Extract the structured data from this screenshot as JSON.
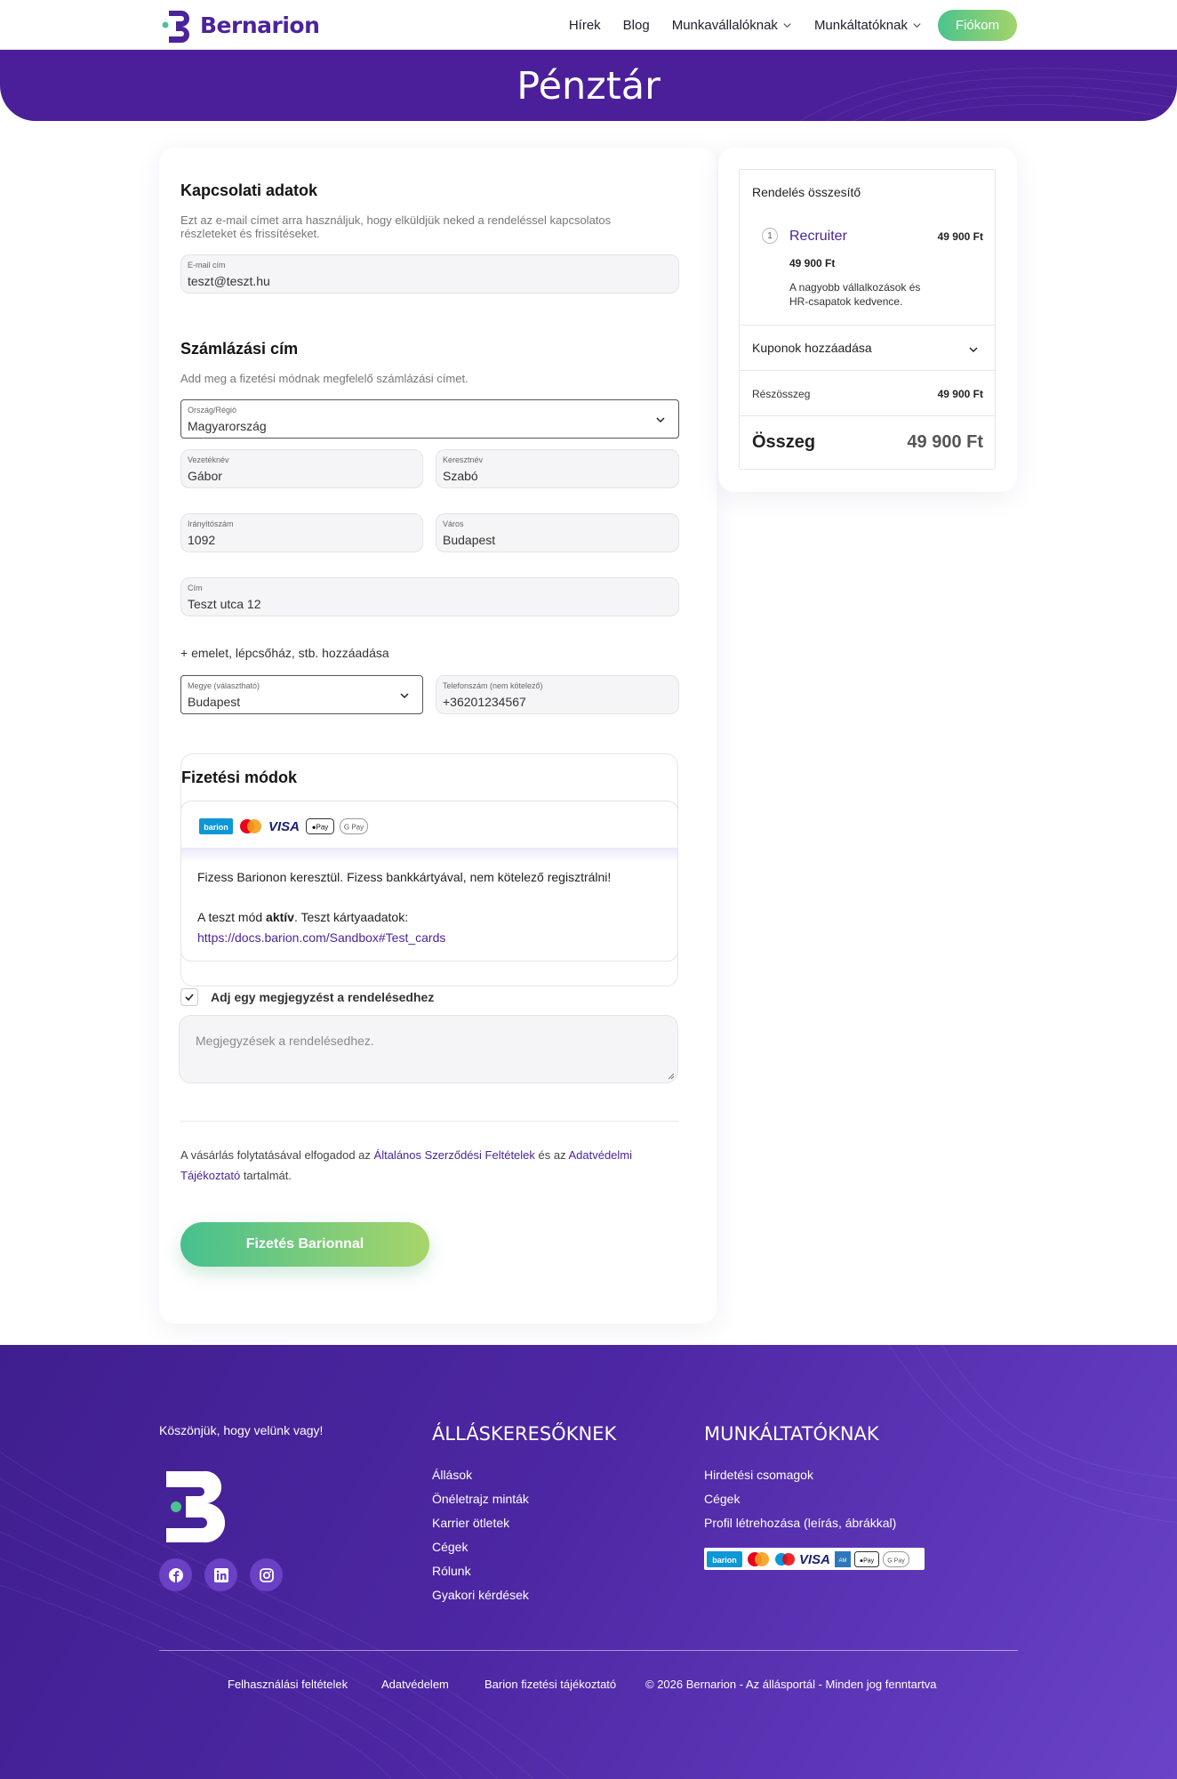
{
  "brand": {
    "name": "Bernarion",
    "accent": "#4b1f99",
    "green": "#4cc38d",
    "lime": "#a8d56a"
  },
  "nav": {
    "items": [
      "Hírek",
      "Blog",
      "Munkavállalóknak",
      "Munkáltatóknak"
    ],
    "account": "Fiókom"
  },
  "page_title": "Pénztár",
  "contact": {
    "title": "Kapcsolati adatok",
    "desc": "Ezt az e-mail címet arra használjuk, hogy elküldjük neked a rendeléssel kapcsolatos részleteket és frissítéseket.",
    "email_label": "E-mail cím",
    "email_value": "teszt@teszt.hu"
  },
  "billing": {
    "title": "Számlázási cím",
    "desc": "Add meg a fizetési módnak megfelelő számlázási címet.",
    "country_label": "Ország/Régió",
    "country_value": "Magyarország",
    "lastname_label": "Vezetéknév",
    "lastname_value": "Gábor",
    "firstname_label": "Keresztnév",
    "firstname_value": "Szabó",
    "zip_label": "Irányítószám",
    "zip_value": "1092",
    "city_label": "Város",
    "city_value": "Budapest",
    "address_label": "Cím",
    "address_value": "Teszt utca 12",
    "add_more": "+ emelet, lépcsőház, stb. hozzáadása",
    "county_label": "Megye (választható)",
    "county_value": "Budapest",
    "phone_label": "Telefonszám (nem kötelező)",
    "phone_value": "+36201234567"
  },
  "payment": {
    "title": "Fizetési módok",
    "logos": [
      "barion",
      "mastercard",
      "VISA",
      "Apple Pay",
      "G Pay"
    ],
    "desc": "Fizess Barionon keresztül. Fizess bankkártyával, nem kötelező regisztrálni!",
    "test_prefix": "A teszt mód ",
    "test_bold": "aktív",
    "test_suffix": ". Teszt kártyaadatok:",
    "test_link": "https://docs.barion.com/Sandbox#Test_cards"
  },
  "note": {
    "checkbox_label": "Adj egy megjegyzést a rendelésedhez",
    "placeholder": "Megjegyzések a rendelésedhez."
  },
  "terms": {
    "part1": "A vásárlás folytatásával elfogadod az ",
    "link1": "Általános Szerződési Feltételek",
    "part2": " és az ",
    "link2": "Adatvédelmi Tájékoztató",
    "part3": " tartalmát."
  },
  "submit": "Fizetés Barionnal",
  "summary": {
    "title": "Rendelés összesítő",
    "item_qty": "1",
    "item_name": "Recruiter",
    "item_price": "49 900 Ft",
    "item_unit_price": "49 900 Ft",
    "item_desc": "A nagyobb vállalkozások és HR-csapatok kedvence.",
    "coupon": "Kuponok hozzáadása",
    "subtotal_label": "Részösszeg",
    "subtotal_value": "49 900 Ft",
    "total_label": "Összeg",
    "total_value": "49 900 Ft"
  },
  "footer": {
    "thanks": "Köszönjük, hogy velünk vagy!",
    "social": [
      "facebook-icon",
      "linkedin-icon",
      "instagram-icon"
    ],
    "col1_title": "ÁLLÁSKERESŐKNEK",
    "col1_links": [
      "Állások",
      "Önéletrajz minták",
      "Karrier ötletek",
      "Cégek",
      "Rólunk",
      "Gyakori kérdések"
    ],
    "col2_title": "MUNKÁLTATÓKNAK",
    "col2_links": [
      "Hirdetési csomagok",
      "Cégek",
      "Profil létrehozása (leírás, ábrákkal)"
    ],
    "bottom_links": [
      "Felhasználási feltételek",
      "Adatvédelem",
      "Barion fizetési tájékoztató"
    ],
    "copyright": "© 2026 Bernarion - Az állásportál - Minden jog fenntartva"
  }
}
